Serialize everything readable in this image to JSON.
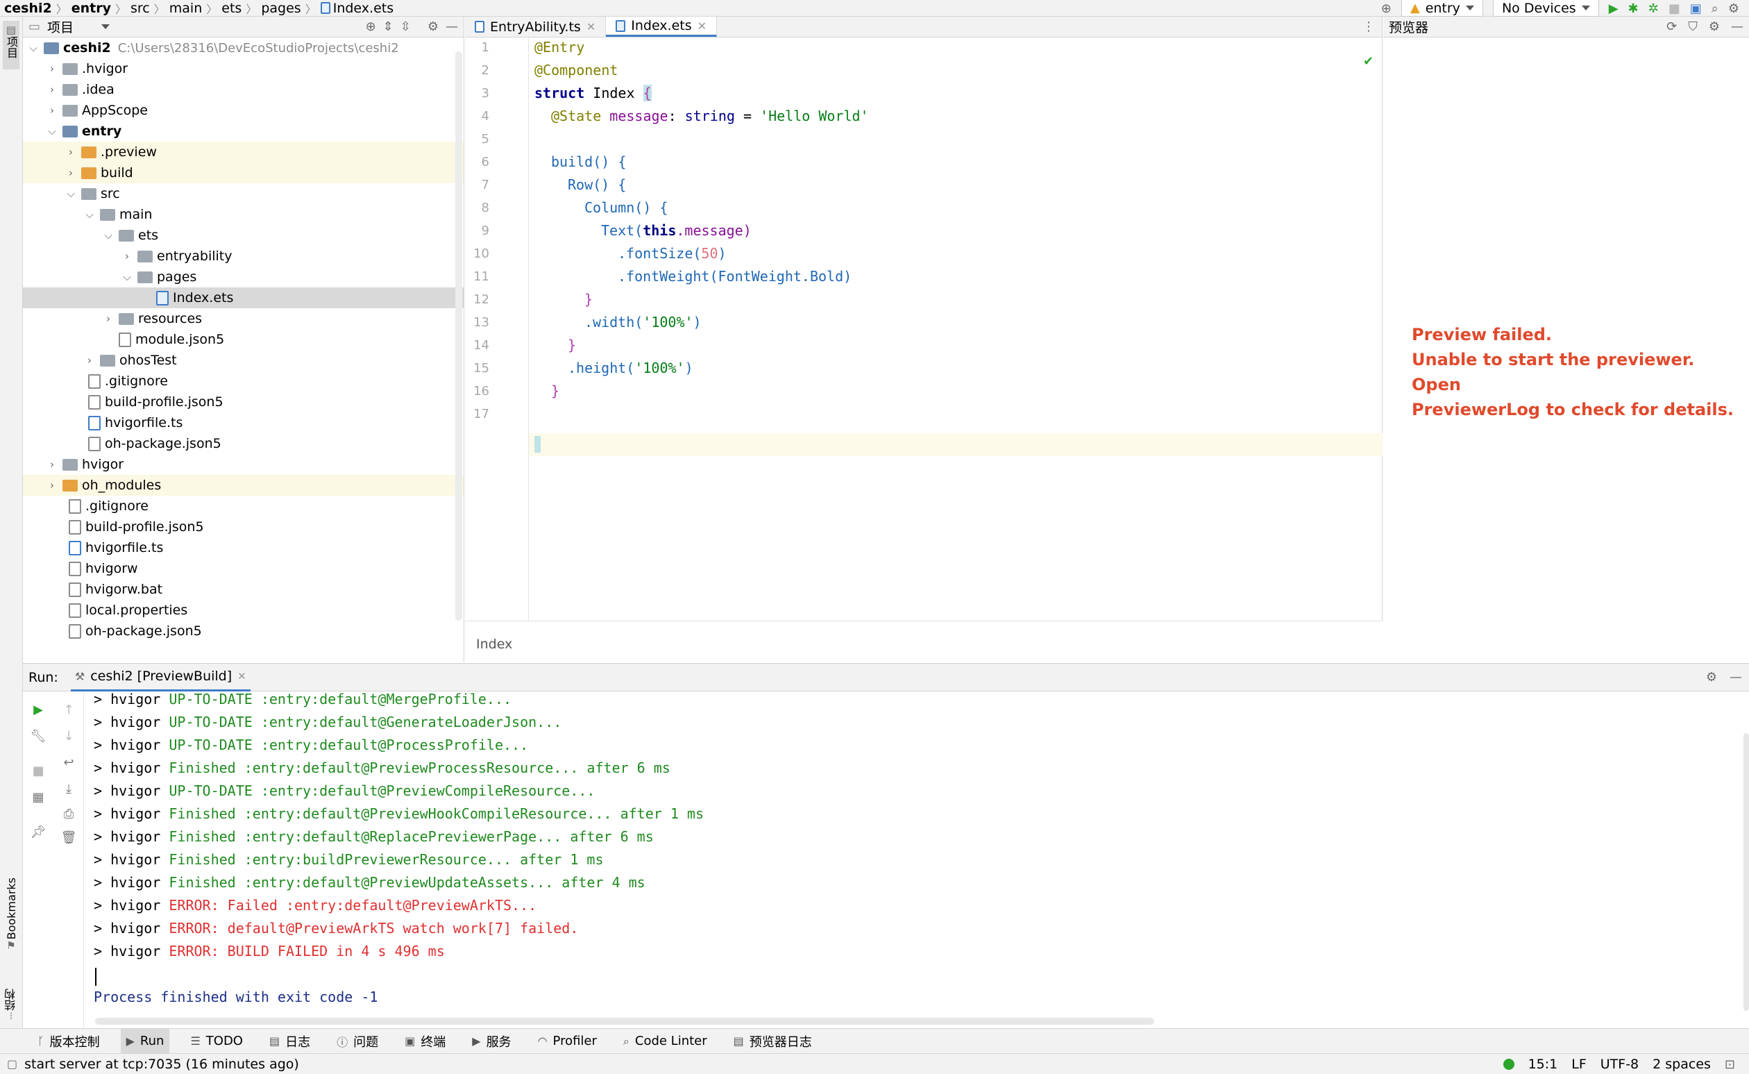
{
  "breadcrumb": [
    "ceshi2",
    "entry",
    "src",
    "main",
    "ets",
    "pages",
    "Index.ets"
  ],
  "toolbar": {
    "module_combo": "entry",
    "device_combo": "No Devices"
  },
  "left_strip": {
    "project_label": "项目",
    "bookmarks_label": "Bookmarks",
    "structure_label": "结构"
  },
  "project": {
    "title": "项目",
    "tree": [
      {
        "label": "ceshi2",
        "sub": "C:\\Users\\28316\\DevEcoStudioProjects\\ceshi2"
      },
      {
        "label": ".hvigor"
      },
      {
        "label": ".idea"
      },
      {
        "label": "AppScope"
      },
      {
        "label": "entry"
      },
      {
        "label": ".preview"
      },
      {
        "label": "build"
      },
      {
        "label": "src"
      },
      {
        "label": "main"
      },
      {
        "label": "ets"
      },
      {
        "label": "entryability"
      },
      {
        "label": "pages"
      },
      {
        "label": "Index.ets"
      },
      {
        "label": "resources"
      },
      {
        "label": "module.json5"
      },
      {
        "label": "ohosTest"
      },
      {
        "label": ".gitignore"
      },
      {
        "label": "build-profile.json5"
      },
      {
        "label": "hvigorfile.ts"
      },
      {
        "label": "oh-package.json5"
      },
      {
        "label": "hvigor"
      },
      {
        "label": "oh_modules"
      },
      {
        "label": ".gitignore"
      },
      {
        "label": "build-profile.json5"
      },
      {
        "label": "hvigorfile.ts"
      },
      {
        "label": "hvigorw"
      },
      {
        "label": "hvigorw.bat"
      },
      {
        "label": "local.properties"
      },
      {
        "label": "oh-package.json5"
      }
    ]
  },
  "editor": {
    "tabs": [
      {
        "label": "EntryAbility.ts"
      },
      {
        "label": "Index.ets"
      }
    ],
    "line_numbers": [
      "1",
      "2",
      "3",
      "4",
      "5",
      "6",
      "7",
      "8",
      "9",
      "10",
      "11",
      "12",
      "13",
      "14",
      "15",
      "16",
      "17"
    ],
    "code": {
      "l1": "@Entry",
      "l2": "@Component",
      "l3_kw": "struct",
      "l3_name": " Index ",
      "l3_brace": "{",
      "l4_ann": "@State",
      "l4_name": " message",
      "l4_colon": ": ",
      "l4_type": "string",
      "l4_eq": " = ",
      "l4_str": "'Hello World'",
      "l6": "build() {",
      "l7": "Row() {",
      "l8": "Column() {",
      "l9_fn": "Text(",
      "l9_this": "this",
      "l9_rest": ".message)",
      "l10_fn": ".fontSize(",
      "l10_num": "50",
      "l10_close": ")",
      "l11": ".fontWeight(FontWeight.Bold)",
      "l12": "}",
      "l13_fn": ".width(",
      "l13_str": "'100%'",
      "l13_close": ")",
      "l14": "}",
      "l15_fn": ".height(",
      "l15_str": "'100%'",
      "l15_close": ")",
      "l16": "}"
    },
    "breadcrumb": "Index"
  },
  "preview": {
    "title": "预览器",
    "message_line1": "Preview failed.",
    "message_line2": "Unable to start the previewer. Open",
    "message_line3": "PreviewerLog to check for details."
  },
  "run": {
    "label": "Run:",
    "tab": "ceshi2 [PreviewBuild]",
    "lines": [
      {
        "prefix": "> hvigor ",
        "text": "UP-TO-DATE :entry:default@MergeProfile...",
        "kind": "green"
      },
      {
        "prefix": "> hvigor ",
        "text": "UP-TO-DATE :entry:default@GenerateLoaderJson...",
        "kind": "green"
      },
      {
        "prefix": "> hvigor ",
        "text": "UP-TO-DATE :entry:default@ProcessProfile...",
        "kind": "green"
      },
      {
        "prefix": "> hvigor ",
        "text": "Finished :entry:default@PreviewProcessResource... after 6 ms",
        "kind": "green"
      },
      {
        "prefix": "> hvigor ",
        "text": "UP-TO-DATE :entry:default@PreviewCompileResource...",
        "kind": "green"
      },
      {
        "prefix": "> hvigor ",
        "text": "Finished :entry:default@PreviewHookCompileResource... after 1 ms",
        "kind": "green"
      },
      {
        "prefix": "> hvigor ",
        "text": "Finished :entry:default@ReplacePreviewerPage... after 6 ms",
        "kind": "green"
      },
      {
        "prefix": "> hvigor ",
        "text": "Finished :entry:buildPreviewerResource... after 1 ms",
        "kind": "green"
      },
      {
        "prefix": "> hvigor ",
        "text": "Finished :entry:default@PreviewUpdateAssets... after 4 ms",
        "kind": "green"
      },
      {
        "prefix": "> hvigor ",
        "text": "ERROR: Failed :entry:default@PreviewArkTS...",
        "kind": "red"
      },
      {
        "prefix": "> hvigor ",
        "text": "ERROR: default@PreviewArkTS watch work[7] failed.",
        "kind": "red"
      },
      {
        "prefix": "> hvigor ",
        "text": "ERROR: BUILD FAILED in 4 s 496 ms",
        "kind": "red"
      }
    ],
    "exit_line": "Process finished with exit code -1"
  },
  "bottom_tools": [
    {
      "label": "版本控制",
      "icon": "branch-icon"
    },
    {
      "label": "Run",
      "icon": "play-icon"
    },
    {
      "label": "TODO",
      "icon": "list-icon"
    },
    {
      "label": "日志",
      "icon": "log-icon"
    },
    {
      "label": "问题",
      "icon": "info-icon"
    },
    {
      "label": "终端",
      "icon": "terminal-icon"
    },
    {
      "label": "服务",
      "icon": "services-icon"
    },
    {
      "label": "Profiler",
      "icon": "gauge-icon"
    },
    {
      "label": "Code Linter",
      "icon": "linter-icon"
    },
    {
      "label": "预览器日志",
      "icon": "doc-icon"
    }
  ],
  "status": {
    "message": "start server at tcp:7035 (16 minutes ago)",
    "position": "15:1",
    "line_sep": "LF",
    "encoding": "UTF-8",
    "indent": "2 spaces"
  },
  "colors": {
    "accent": "#3d7cc9",
    "error": "#e03030",
    "success": "#1f8a1f",
    "preview_error": "#e04a2c"
  }
}
